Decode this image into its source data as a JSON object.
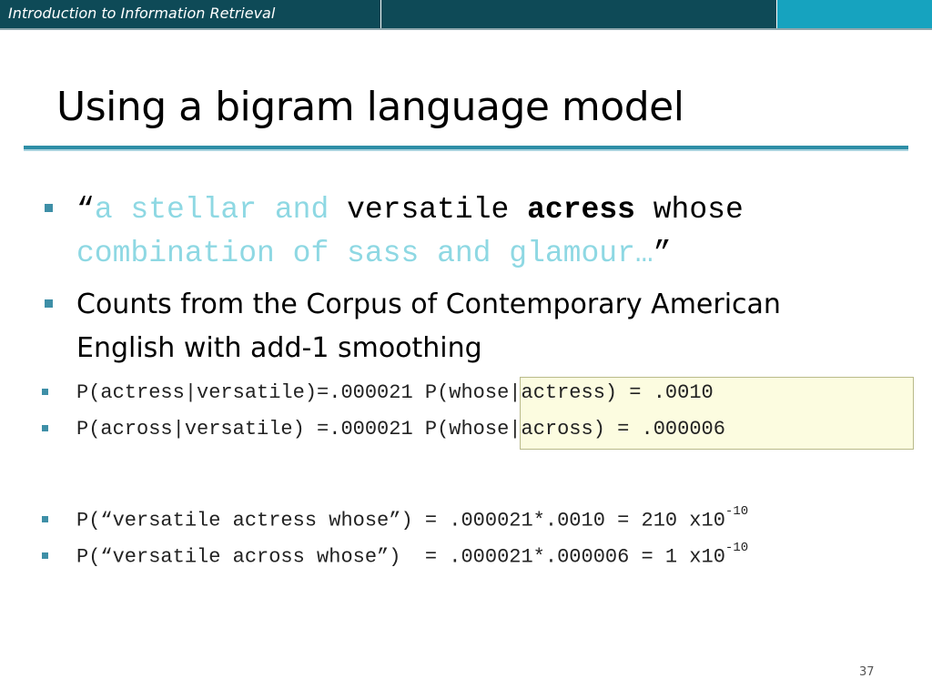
{
  "header": {
    "course_title": "Introduction to Information Retrieval"
  },
  "slide": {
    "title": "Using a bigram language model",
    "quote": {
      "open_quote": "“",
      "part1_cyan": "a stellar and",
      "part2_black": " versatile ",
      "misspelling": "acress",
      "part3_black": " whose",
      "line2_cyan": "combination of sass and glamour…",
      "close_quote": "”"
    },
    "counts_line1": "Counts from the Corpus of Contemporary American",
    "counts_line2": "English with add-1 smoothing",
    "p1_left": "P(actress|versatile)=.000021",
    "p1_right": "P(whose|actress) = .0010",
    "p2_left": "P(across|versatile) =.000021",
    "p2_right": "P(whose|across) = .000006",
    "p3_text": "P(“versatile actress whose”) = .000021*.0010 = 210 x10",
    "p3_exp": "-10",
    "p4_text": "P(“versatile across whose”)  = .000021*.000006 = 1 x10",
    "p4_exp": "-10",
    "page_number": "37"
  },
  "colors": {
    "header_dark": "#0e4a57",
    "header_accent": "#16a3bf",
    "bullet": "#3e8fa7",
    "cyan_text": "#8ed8e3",
    "highlight_bg": "#fcfce0"
  }
}
